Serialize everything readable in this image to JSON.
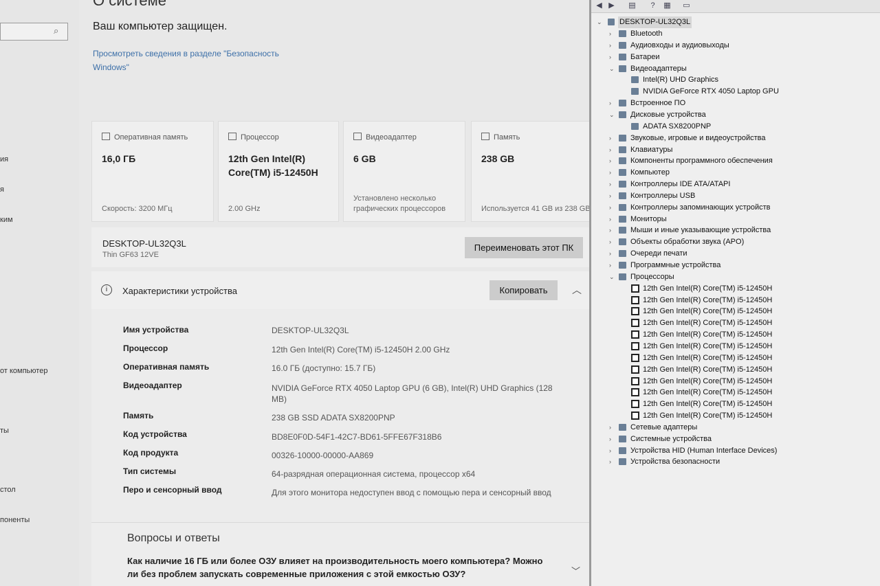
{
  "settings": {
    "page_title": "О системе",
    "protected_text": "Ваш компьютер защищен.",
    "security_link": "Просмотреть сведения в разделе \"Безопасность Windows\"",
    "left_nav": [
      "ия",
      "я",
      "ким",
      "от компьютер",
      "ты",
      "стол",
      "поненты"
    ],
    "tiles": [
      {
        "title": "Оперативная память",
        "value": "16,0 ГБ",
        "foot": "Скорость: 3200 МГц"
      },
      {
        "title": "Процессор",
        "value": "12th Gen Intel(R) Core(TM) i5-12450H",
        "foot": "2.00 GHz"
      },
      {
        "title": "Видеоадаптер",
        "value": "6 GB",
        "foot": "Установлено несколько графических процессоров"
      },
      {
        "title": "Память",
        "value": "238 GB",
        "foot": "Используется 41 GB из 238 GB"
      }
    ],
    "pc_name": "DESKTOP-UL32Q3L",
    "pc_model": "Thin GF63 12VE",
    "rename_button": "Переименовать этот ПК",
    "spec_title": "Характеристики устройства",
    "copy_button": "Копировать",
    "specs": [
      {
        "label": "Имя устройства",
        "value": "DESKTOP-UL32Q3L"
      },
      {
        "label": "Процессор",
        "value": "12th Gen Intel(R) Core(TM) i5-12450H   2.00 GHz"
      },
      {
        "label": "Оперативная память",
        "value": "16.0 ГБ (доступно: 15.7 ГБ)"
      },
      {
        "label": "Видеоадаптер",
        "value": "NVIDIA GeForce RTX 4050 Laptop GPU (6 GB), Intel(R) UHD Graphics (128 MB)"
      },
      {
        "label": "Память",
        "value": "238 GB SSD ADATA SX8200PNP"
      },
      {
        "label": "Код устройства",
        "value": "BD8E0F0D-54F1-42C7-BD61-5FFE67F318B6"
      },
      {
        "label": "Код продукта",
        "value": "00326-10000-00000-AA869"
      },
      {
        "label": "Тип системы",
        "value": "64-разрядная операционная система, процессор x64"
      },
      {
        "label": "Перо и сенсорный ввод",
        "value": "Для этого монитора недоступен ввод с помощью пера и сенсорный ввод"
      }
    ],
    "faq_title": "Вопросы и ответы",
    "faq_question": "Как наличие 16 ГБ или более ОЗУ влияет на производительность моего компьютера? Можно ли без проблем запускать современные приложения с этой емкостью ОЗУ?"
  },
  "device_manager": {
    "root": "DESKTOP-UL32Q3L",
    "nodes": [
      {
        "text": "Bluetooth",
        "level": 1,
        "toggle": "›"
      },
      {
        "text": "Аудиовходы и аудиовыходы",
        "level": 1,
        "toggle": "›"
      },
      {
        "text": "Батареи",
        "level": 1,
        "toggle": "›"
      },
      {
        "text": "Видеоадаптеры",
        "level": 1,
        "toggle": "⌄"
      },
      {
        "text": "Intel(R) UHD Graphics",
        "level": 2,
        "toggle": ""
      },
      {
        "text": "NVIDIA GeForce RTX 4050 Laptop GPU",
        "level": 2,
        "toggle": ""
      },
      {
        "text": "Встроенное ПО",
        "level": 1,
        "toggle": "›"
      },
      {
        "text": "Дисковые устройства",
        "level": 1,
        "toggle": "⌄"
      },
      {
        "text": "ADATA SX8200PNP",
        "level": 2,
        "toggle": ""
      },
      {
        "text": "Звуковые, игровые и видеоустройства",
        "level": 1,
        "toggle": "›"
      },
      {
        "text": "Клавиатуры",
        "level": 1,
        "toggle": "›"
      },
      {
        "text": "Компоненты программного обеспечения",
        "level": 1,
        "toggle": "›"
      },
      {
        "text": "Компьютер",
        "level": 1,
        "toggle": "›"
      },
      {
        "text": "Контроллеры IDE ATA/ATAPI",
        "level": 1,
        "toggle": "›"
      },
      {
        "text": "Контроллеры USB",
        "level": 1,
        "toggle": "›"
      },
      {
        "text": "Контроллеры запоминающих устройств",
        "level": 1,
        "toggle": "›"
      },
      {
        "text": "Мониторы",
        "level": 1,
        "toggle": "›"
      },
      {
        "text": "Мыши и иные указывающие устройства",
        "level": 1,
        "toggle": "›"
      },
      {
        "text": "Объекты обработки звука (APO)",
        "level": 1,
        "toggle": "›"
      },
      {
        "text": "Очереди печати",
        "level": 1,
        "toggle": "›"
      },
      {
        "text": "Программные устройства",
        "level": 1,
        "toggle": "›"
      },
      {
        "text": "Процессоры",
        "level": 1,
        "toggle": "⌄"
      },
      {
        "text": "12th Gen Intel(R) Core(TM) i5-12450H",
        "level": 2,
        "toggle": "",
        "proc": true
      },
      {
        "text": "12th Gen Intel(R) Core(TM) i5-12450H",
        "level": 2,
        "toggle": "",
        "proc": true
      },
      {
        "text": "12th Gen Intel(R) Core(TM) i5-12450H",
        "level": 2,
        "toggle": "",
        "proc": true
      },
      {
        "text": "12th Gen Intel(R) Core(TM) i5-12450H",
        "level": 2,
        "toggle": "",
        "proc": true
      },
      {
        "text": "12th Gen Intel(R) Core(TM) i5-12450H",
        "level": 2,
        "toggle": "",
        "proc": true
      },
      {
        "text": "12th Gen Intel(R) Core(TM) i5-12450H",
        "level": 2,
        "toggle": "",
        "proc": true
      },
      {
        "text": "12th Gen Intel(R) Core(TM) i5-12450H",
        "level": 2,
        "toggle": "",
        "proc": true
      },
      {
        "text": "12th Gen Intel(R) Core(TM) i5-12450H",
        "level": 2,
        "toggle": "",
        "proc": true
      },
      {
        "text": "12th Gen Intel(R) Core(TM) i5-12450H",
        "level": 2,
        "toggle": "",
        "proc": true
      },
      {
        "text": "12th Gen Intel(R) Core(TM) i5-12450H",
        "level": 2,
        "toggle": "",
        "proc": true
      },
      {
        "text": "12th Gen Intel(R) Core(TM) i5-12450H",
        "level": 2,
        "toggle": "",
        "proc": true
      },
      {
        "text": "12th Gen Intel(R) Core(TM) i5-12450H",
        "level": 2,
        "toggle": "",
        "proc": true
      },
      {
        "text": "Сетевые адаптеры",
        "level": 1,
        "toggle": "›"
      },
      {
        "text": "Системные устройства",
        "level": 1,
        "toggle": "›"
      },
      {
        "text": "Устройства HID (Human Interface Devices)",
        "level": 1,
        "toggle": "›"
      },
      {
        "text": "Устройства безопасности",
        "level": 1,
        "toggle": "›"
      }
    ]
  }
}
